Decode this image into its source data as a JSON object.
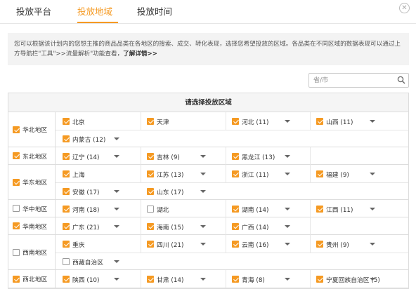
{
  "tabs": [
    {
      "label": "投放平台"
    },
    {
      "label": "投放地域"
    },
    {
      "label": "投放时间"
    }
  ],
  "close_icon": "close-icon",
  "info": {
    "text": "您可以根据该计划内的您想主推的商品品类在各地区的搜索、成交、转化表现，选择您希望投放的区域。各品类在不同区域的数据表现可以通过上方导航栏\"工具\">>流量解析\"功能查看，",
    "link": "了解详情>>"
  },
  "search": {
    "placeholder": "省/市",
    "icon": "search-icon"
  },
  "table_title": "请选择投放区域",
  "accent_color": "#f59a23",
  "regions": [
    {
      "name": "华北地区",
      "checked": true,
      "provinces": [
        {
          "name": "北京",
          "checked": true,
          "caret": false
        },
        {
          "name": "天津",
          "checked": true,
          "caret": false
        },
        {
          "name": "河北 (11)",
          "checked": true,
          "caret": true
        },
        {
          "name": "山西 (11)",
          "checked": true,
          "caret": true
        },
        {
          "name": "内蒙古 (12)",
          "checked": true,
          "caret": true
        }
      ]
    },
    {
      "name": "东北地区",
      "checked": true,
      "provinces": [
        {
          "name": "辽宁 (14)",
          "checked": true,
          "caret": true
        },
        {
          "name": "吉林 (9)",
          "checked": true,
          "caret": true
        },
        {
          "name": "黑龙江 (13)",
          "checked": true,
          "caret": true
        }
      ]
    },
    {
      "name": "华东地区",
      "checked": true,
      "provinces": [
        {
          "name": "上海",
          "checked": true,
          "caret": false
        },
        {
          "name": "江苏 (13)",
          "checked": true,
          "caret": true
        },
        {
          "name": "浙江 (11)",
          "checked": true,
          "caret": true
        },
        {
          "name": "福建 (9)",
          "checked": true,
          "caret": true
        },
        {
          "name": "安徽 (17)",
          "checked": true,
          "caret": true
        },
        {
          "name": "山东 (17)",
          "checked": true,
          "caret": true
        }
      ]
    },
    {
      "name": "华中地区",
      "checked": false,
      "provinces": [
        {
          "name": "河南 (18)",
          "checked": true,
          "caret": true
        },
        {
          "name": "湖北",
          "checked": false,
          "caret": false
        },
        {
          "name": "湖南 (14)",
          "checked": true,
          "caret": true
        },
        {
          "name": "江西 (11)",
          "checked": true,
          "caret": true
        }
      ]
    },
    {
      "name": "华南地区",
      "checked": true,
      "provinces": [
        {
          "name": "广东 (21)",
          "checked": true,
          "caret": true
        },
        {
          "name": "海南 (15)",
          "checked": true,
          "caret": true
        },
        {
          "name": "广西 (14)",
          "checked": true,
          "caret": true
        }
      ]
    },
    {
      "name": "西南地区",
      "checked": false,
      "provinces": [
        {
          "name": "重庆",
          "checked": true,
          "caret": false
        },
        {
          "name": "四川 (21)",
          "checked": true,
          "caret": true
        },
        {
          "name": "云南 (16)",
          "checked": true,
          "caret": true
        },
        {
          "name": "贵州 (9)",
          "checked": true,
          "caret": true
        },
        {
          "name": "西藏自治区",
          "checked": false,
          "caret": true
        }
      ]
    },
    {
      "name": "西北地区",
      "checked": true,
      "provinces": [
        {
          "name": "陕西 (10)",
          "checked": true,
          "caret": true
        },
        {
          "name": "甘肃 (14)",
          "checked": true,
          "caret": true
        },
        {
          "name": "青海 (8)",
          "checked": true,
          "caret": true
        },
        {
          "name": "宁夏回族自治区 (5)",
          "checked": true,
          "caret": true
        }
      ]
    }
  ]
}
